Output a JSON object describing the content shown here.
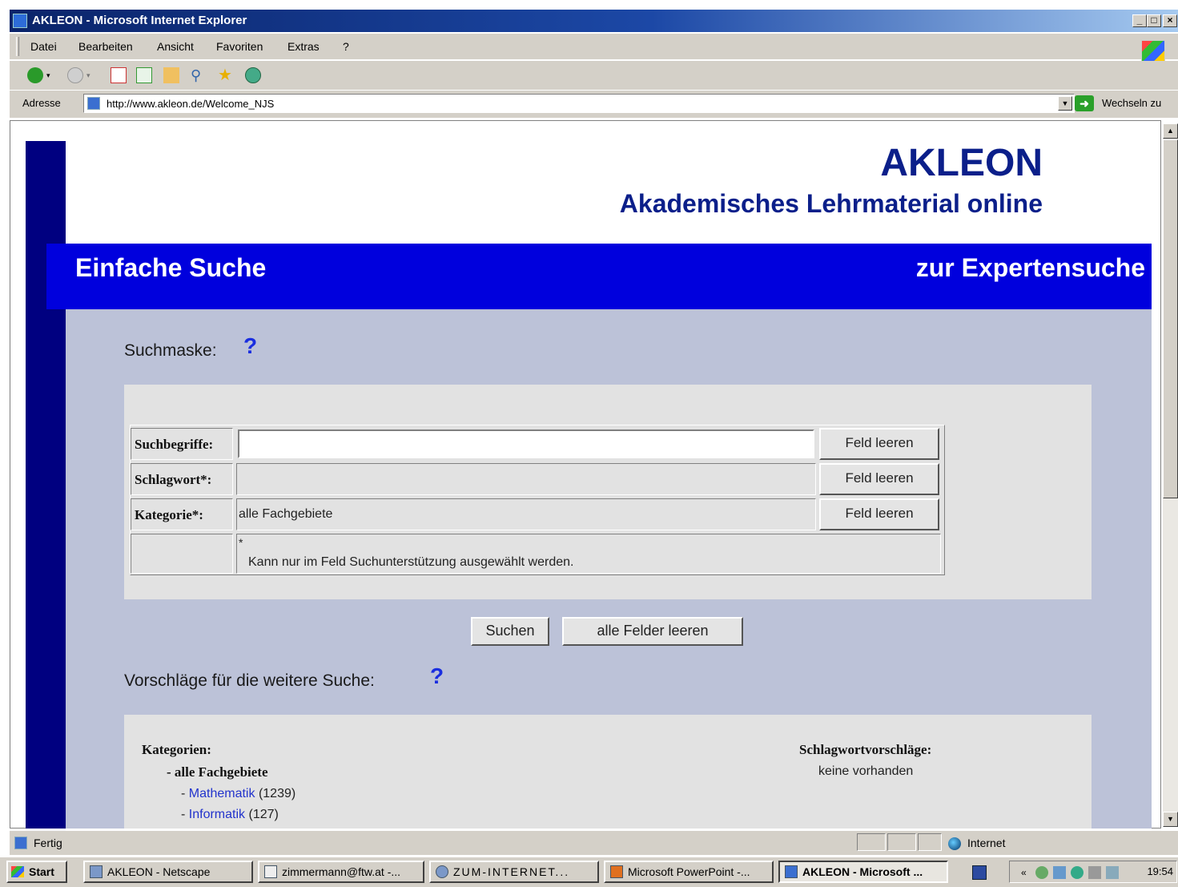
{
  "window": {
    "title": "AKLEON - Microsoft Internet Explorer",
    "buttons": {
      "minimize": "_",
      "maximize": "□",
      "close": "×"
    }
  },
  "menu": {
    "items": [
      "Datei",
      "Bearbeiten",
      "Ansicht",
      "Favoriten",
      "Extras",
      "?"
    ]
  },
  "addressbar": {
    "label": "Adresse",
    "url": "http://www.akleon.de/Welcome_NJS",
    "go_label": "Wechseln zu"
  },
  "page": {
    "brand_name": "AKLEON",
    "brand_subtitle": "Akademisches Lehrmaterial online",
    "banner_title": "Einfache Suche",
    "expert_link": "zur Expertensuche",
    "search_section_title": "Suchmaske:",
    "help_mark": "?",
    "form": {
      "rows": [
        {
          "label": "Suchbegriffe:",
          "value": "",
          "button": "Feld leeren"
        },
        {
          "label": "Schlagwort*:",
          "value": "",
          "button": "Feld leeren"
        },
        {
          "label": "Kategorie*:",
          "value": "alle Fachgebiete",
          "button": "Feld leeren"
        }
      ],
      "footnote_mark": "*",
      "footnote": "Kann nur im Feld Suchunterstützung ausgewählt werden."
    },
    "buttons": {
      "search": "Suchen",
      "clear_all": "alle Felder leeren"
    },
    "suggestions_title": "Vorschläge für die weitere Suche:",
    "categories": {
      "heading": "Kategorien:",
      "root": "- alle Fachgebiete",
      "items": [
        {
          "prefix": "- ",
          "name": "Mathematik",
          "count": "(1239)"
        },
        {
          "prefix": "- ",
          "name": "Informatik",
          "count": "(127)"
        }
      ]
    },
    "keywords": {
      "heading": "Schlagwortvorschläge:",
      "text": "keine vorhanden"
    }
  },
  "statusbar": {
    "status": "Fertig",
    "zone": "Internet"
  },
  "taskbar": {
    "start": "Start",
    "tasks": [
      {
        "label": "AKLEON - Netscape",
        "active": false
      },
      {
        "label": "zimmermann@ftw.at -...",
        "active": false
      },
      {
        "label": "ZUM-INTERNET...",
        "active": false
      },
      {
        "label": "Microsoft PowerPoint -...",
        "active": false
      },
      {
        "label": "AKLEON - Microsoft ...",
        "active": true
      }
    ],
    "clock": "19:54"
  },
  "colors": {
    "navy": "#000080",
    "banner_blue": "#0000dd",
    "panel": "#bcc2d8",
    "link": "#2233cc"
  }
}
